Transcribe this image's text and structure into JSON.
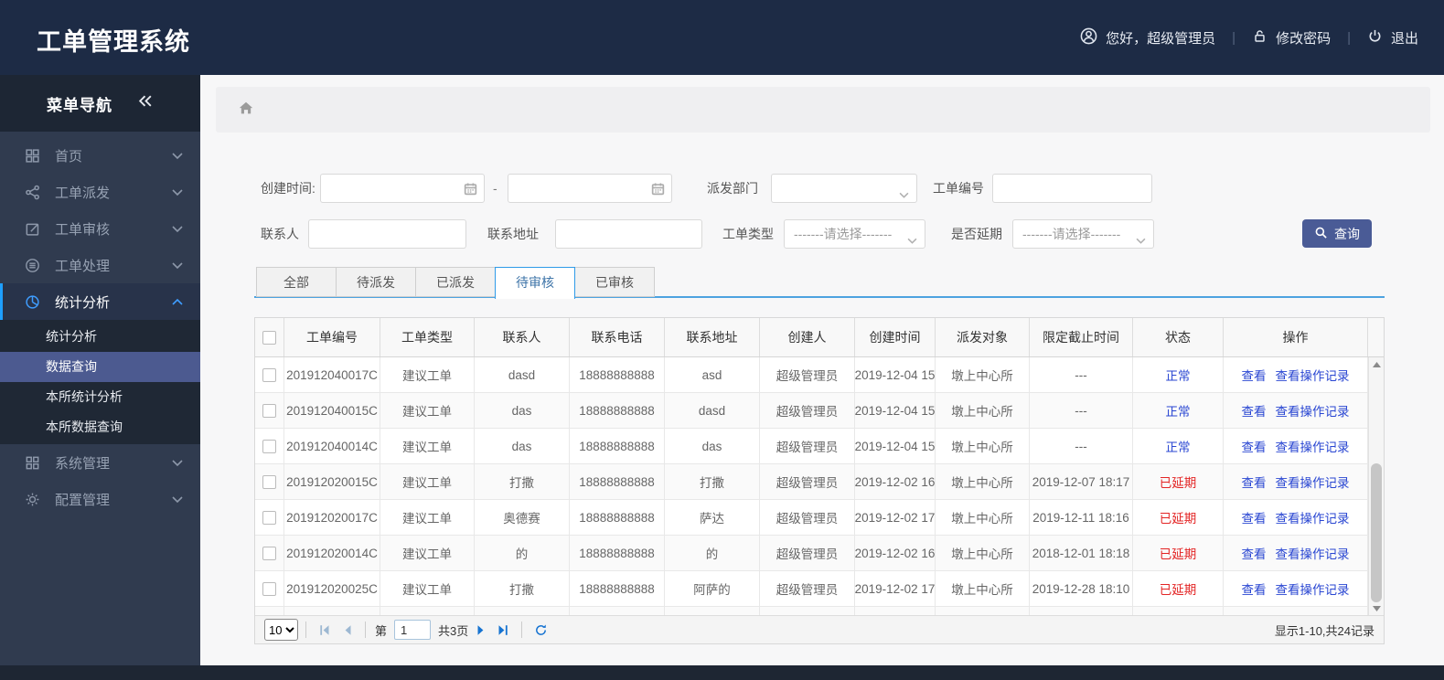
{
  "header": {
    "title": "工单管理系统",
    "greeting": "您好，超级管理员",
    "change_password": "修改密码",
    "logout": "退出"
  },
  "sidebar": {
    "nav_title": "菜单导航",
    "items": [
      {
        "label": "首页",
        "icon": "grid"
      },
      {
        "label": "工单派发",
        "icon": "share"
      },
      {
        "label": "工单审核",
        "icon": "edit"
      },
      {
        "label": "工单处理",
        "icon": "process"
      },
      {
        "label": "统计分析",
        "icon": "pie",
        "active": true,
        "children": [
          "统计分析",
          "数据查询",
          "本所统计分析",
          "本所数据查询"
        ],
        "selected_child": "数据查询"
      },
      {
        "label": "系统管理",
        "icon": "grid2"
      },
      {
        "label": "配置管理",
        "icon": "gear"
      }
    ]
  },
  "filters": {
    "create_time_label": "创建时间:",
    "range_separator": "-",
    "dispatch_dept_label": "派发部门",
    "order_no_label": "工单编号",
    "contact_label": "联系人",
    "address_label": "联系地址",
    "order_type_label": "工单类型",
    "delay_label": "是否延期",
    "select_placeholder": "-------请选择-------",
    "search_button": "查询"
  },
  "tabs": [
    {
      "label": "全部",
      "active": false
    },
    {
      "label": "待派发",
      "active": false
    },
    {
      "label": "已派发",
      "active": false
    },
    {
      "label": "待审核",
      "active": true
    },
    {
      "label": "已审核",
      "active": false
    }
  ],
  "table": {
    "headers": [
      "工单编号",
      "工单类型",
      "联系人",
      "联系电话",
      "联系地址",
      "创建人",
      "创建时间",
      "派发对象",
      "限定截止时间",
      "状态",
      "操作"
    ],
    "view_label": "查看",
    "view_log_label": "查看操作记录",
    "partial_row_visible": true,
    "rows": [
      {
        "order_no": "201912040017C",
        "type": "建议工单",
        "contact": "dasd",
        "phone": "18888888888",
        "address": "asd",
        "creator": "超级管理员",
        "create_time": "2019-12-04 15",
        "target": "墩上中心所",
        "deadline": "---",
        "status": "正常",
        "status_type": "normal"
      },
      {
        "order_no": "201912040015C",
        "type": "建议工单",
        "contact": "das",
        "phone": "18888888888",
        "address": "dasd",
        "creator": "超级管理员",
        "create_time": "2019-12-04 15",
        "target": "墩上中心所",
        "deadline": "---",
        "status": "正常",
        "status_type": "normal"
      },
      {
        "order_no": "201912040014C",
        "type": "建议工单",
        "contact": "das",
        "phone": "18888888888",
        "address": "das",
        "creator": "超级管理员",
        "create_time": "2019-12-04 15",
        "target": "墩上中心所",
        "deadline": "---",
        "status": "正常",
        "status_type": "normal"
      },
      {
        "order_no": "201912020015C",
        "type": "建议工单",
        "contact": "打撒",
        "phone": "18888888888",
        "address": "打撒",
        "creator": "超级管理员",
        "create_time": "2019-12-02 16",
        "target": "墩上中心所",
        "deadline": "2019-12-07 18:17",
        "status": "已延期",
        "status_type": "delayed"
      },
      {
        "order_no": "201912020017C",
        "type": "建议工单",
        "contact": "奥德赛",
        "phone": "18888888888",
        "address": "萨达",
        "creator": "超级管理员",
        "create_time": "2019-12-02 17",
        "target": "墩上中心所",
        "deadline": "2019-12-11 18:16",
        "status": "已延期",
        "status_type": "delayed"
      },
      {
        "order_no": "201912020014C",
        "type": "建议工单",
        "contact": "的",
        "phone": "18888888888",
        "address": "的",
        "creator": "超级管理员",
        "create_time": "2019-12-02 16",
        "target": "墩上中心所",
        "deadline": "2018-12-01 18:18",
        "status": "已延期",
        "status_type": "delayed"
      },
      {
        "order_no": "201912020025C",
        "type": "建议工单",
        "contact": "打撒",
        "phone": "18888888888",
        "address": "阿萨的",
        "creator": "超级管理员",
        "create_time": "2019-12-02 17",
        "target": "墩上中心所",
        "deadline": "2019-12-28 18:10",
        "status": "已延期",
        "status_type": "delayed"
      }
    ]
  },
  "pagination": {
    "page_size": "10",
    "page_prefix": "第",
    "current_page": "1",
    "total_pages": "共3页",
    "summary": "显示1-10,共24记录"
  },
  "colors": {
    "header_bg": "#1d2b45",
    "sidebar_bg": "#303b4f",
    "sidebar_selected_bg": "#4c5a90",
    "accent_blue": "#1e9fff",
    "tab_underline": "#4da3e0",
    "link_blue": "#2946d2",
    "status_normal": "#2946d2",
    "status_delayed": "#e32424",
    "search_button_bg": "#4a5b96"
  }
}
